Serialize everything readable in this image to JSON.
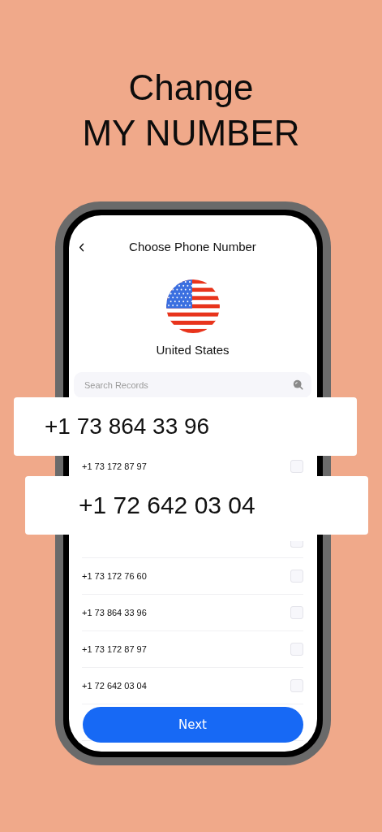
{
  "headline": {
    "line_1": "Change",
    "line_2": "MY NUMBER"
  },
  "screen": {
    "title": "Choose Phone Number",
    "country": "United States",
    "search": {
      "placeholder": "Search Records"
    },
    "rows": [
      {
        "kind": "blank"
      },
      {
        "kind": "number",
        "number": "+1 73 172 87 97",
        "checked": false
      },
      {
        "kind": "blank"
      },
      {
        "kind": "checkbox_bottom",
        "checked": false
      },
      {
        "kind": "number",
        "number": "+1 73 172 76 60",
        "checked": false
      },
      {
        "kind": "number",
        "number": "+1 73 864 33 96",
        "checked": false
      },
      {
        "kind": "number",
        "number": "+1 73 172 87 97",
        "checked": false
      },
      {
        "kind": "number",
        "number": "+1 72 642 03 04",
        "checked": false
      },
      {
        "kind": "blank"
      },
      {
        "kind": "blank"
      }
    ],
    "next_button": "Next"
  },
  "callouts": [
    "+1 73 864 33 96",
    "+1 72 642 03 04"
  ]
}
